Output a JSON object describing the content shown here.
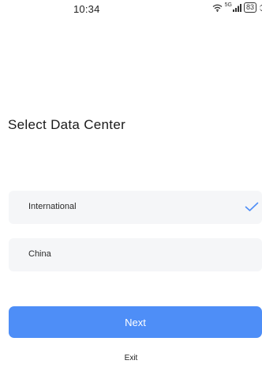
{
  "status_bar": {
    "time": "10:34",
    "network_label": "5G",
    "battery_level": "83",
    "icons": [
      "wifi-icon",
      "signal-icon",
      "battery-icon"
    ]
  },
  "page": {
    "title": "Select Data Center"
  },
  "options": [
    {
      "label": "International",
      "selected": true
    },
    {
      "label": "China",
      "selected": false
    }
  ],
  "actions": {
    "next_label": "Next",
    "exit_label": "Exit"
  },
  "colors": {
    "accent": "#4e8ef7",
    "option_background": "#f5f6f8",
    "check": "#4e8ef7"
  }
}
